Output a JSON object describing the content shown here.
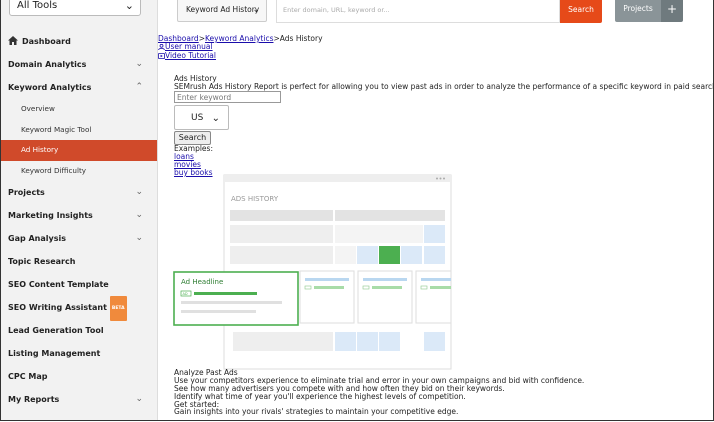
{
  "sidebar": {
    "tools_select": "All Tools",
    "items": [
      {
        "label": "Dashboard"
      },
      {
        "label": "Domain Analytics"
      },
      {
        "label": "Keyword Analytics"
      },
      {
        "label": "Overview"
      },
      {
        "label": "Keyword Magic Tool"
      },
      {
        "label": "Ad History"
      },
      {
        "label": "Keyword Difficulty"
      },
      {
        "label": "Projects"
      },
      {
        "label": "Marketing Insights"
      },
      {
        "label": "Gap Analysis"
      },
      {
        "label": "Topic Research"
      },
      {
        "label": "SEO Content Template"
      },
      {
        "label": "SEO Writing Assistant",
        "badge": "BETA"
      },
      {
        "label": "Lead Generation Tool"
      },
      {
        "label": "Listing Management"
      },
      {
        "label": "CPC Map"
      },
      {
        "label": "My Reports"
      }
    ]
  },
  "topbar": {
    "dropdown_label": "Keyword Ad History",
    "search_placeholder": "Enter domain, URL, keyword or...",
    "search_button": "Search",
    "projects_button": "Projects",
    "plus_button": "+"
  },
  "breadcrumb": {
    "items": [
      "Dashboard",
      "Keyword Analytics",
      "Ads History"
    ],
    "separator": ">"
  },
  "links": {
    "user_manual": "User manual",
    "video_tutorial": "Video Tutorial"
  },
  "ads_history": {
    "title": "Ads History",
    "description": "SEMrush Ads History Report is perfect for allowing you to view past ads in order to analyze the performance of a specific keyword in paid search.",
    "keyword_placeholder": "Enter keyword",
    "country": "US",
    "search_button": "Search",
    "examples_label": "Examples:",
    "examples": [
      "loans",
      "movies",
      "buy books"
    ]
  },
  "illustration": {
    "header": "ADS HISTORY",
    "ad_headline": "Ad Headline",
    "ad_badge": "AD"
  },
  "analyze": {
    "title": "Analyze Past Ads",
    "lines": [
      "Use your competitors experience to eliminate trial and error in your own campaigns and bid with confidence.",
      "See how many advertisers you compete with and how often they bid on their keywords.",
      "Identify what time of year you'll experience the highest levels of competition.",
      "Get started:",
      "Gain insights into your rivals' strategies to maintain your competitive edge."
    ]
  },
  "colors": {
    "accent": "#d04a2a",
    "search_orange": "#e64a19",
    "projects_gray": "#8a9498",
    "link": "#1a0dab",
    "green": "#4caf50"
  }
}
